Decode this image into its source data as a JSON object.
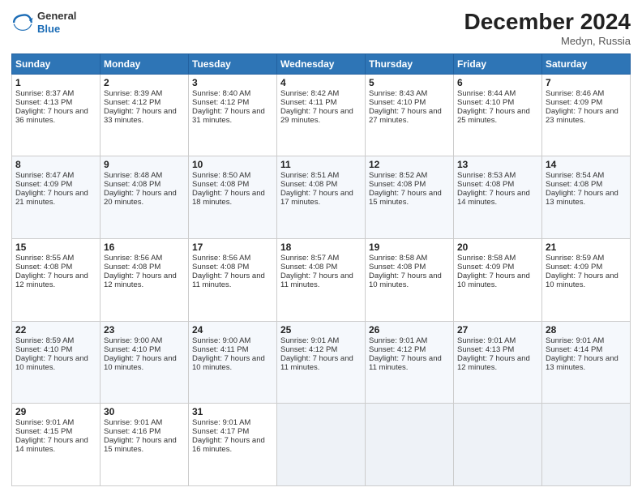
{
  "header": {
    "logo_general": "General",
    "logo_blue": "Blue",
    "month": "December 2024",
    "location": "Medyn, Russia"
  },
  "weekdays": [
    "Sunday",
    "Monday",
    "Tuesday",
    "Wednesday",
    "Thursday",
    "Friday",
    "Saturday"
  ],
  "weeks": [
    [
      {
        "day": "1",
        "sunrise": "8:37 AM",
        "sunset": "4:13 PM",
        "daylight": "7 hours and 36 minutes."
      },
      {
        "day": "2",
        "sunrise": "8:39 AM",
        "sunset": "4:12 PM",
        "daylight": "7 hours and 33 minutes."
      },
      {
        "day": "3",
        "sunrise": "8:40 AM",
        "sunset": "4:12 PM",
        "daylight": "7 hours and 31 minutes."
      },
      {
        "day": "4",
        "sunrise": "8:42 AM",
        "sunset": "4:11 PM",
        "daylight": "7 hours and 29 minutes."
      },
      {
        "day": "5",
        "sunrise": "8:43 AM",
        "sunset": "4:10 PM",
        "daylight": "7 hours and 27 minutes."
      },
      {
        "day": "6",
        "sunrise": "8:44 AM",
        "sunset": "4:10 PM",
        "daylight": "7 hours and 25 minutes."
      },
      {
        "day": "7",
        "sunrise": "8:46 AM",
        "sunset": "4:09 PM",
        "daylight": "7 hours and 23 minutes."
      }
    ],
    [
      {
        "day": "8",
        "sunrise": "8:47 AM",
        "sunset": "4:09 PM",
        "daylight": "7 hours and 21 minutes."
      },
      {
        "day": "9",
        "sunrise": "8:48 AM",
        "sunset": "4:08 PM",
        "daylight": "7 hours and 20 minutes."
      },
      {
        "day": "10",
        "sunrise": "8:50 AM",
        "sunset": "4:08 PM",
        "daylight": "7 hours and 18 minutes."
      },
      {
        "day": "11",
        "sunrise": "8:51 AM",
        "sunset": "4:08 PM",
        "daylight": "7 hours and 17 minutes."
      },
      {
        "day": "12",
        "sunrise": "8:52 AM",
        "sunset": "4:08 PM",
        "daylight": "7 hours and 15 minutes."
      },
      {
        "day": "13",
        "sunrise": "8:53 AM",
        "sunset": "4:08 PM",
        "daylight": "7 hours and 14 minutes."
      },
      {
        "day": "14",
        "sunrise": "8:54 AM",
        "sunset": "4:08 PM",
        "daylight": "7 hours and 13 minutes."
      }
    ],
    [
      {
        "day": "15",
        "sunrise": "8:55 AM",
        "sunset": "4:08 PM",
        "daylight": "7 hours and 12 minutes."
      },
      {
        "day": "16",
        "sunrise": "8:56 AM",
        "sunset": "4:08 PM",
        "daylight": "7 hours and 12 minutes."
      },
      {
        "day": "17",
        "sunrise": "8:56 AM",
        "sunset": "4:08 PM",
        "daylight": "7 hours and 11 minutes."
      },
      {
        "day": "18",
        "sunrise": "8:57 AM",
        "sunset": "4:08 PM",
        "daylight": "7 hours and 11 minutes."
      },
      {
        "day": "19",
        "sunrise": "8:58 AM",
        "sunset": "4:08 PM",
        "daylight": "7 hours and 10 minutes."
      },
      {
        "day": "20",
        "sunrise": "8:58 AM",
        "sunset": "4:09 PM",
        "daylight": "7 hours and 10 minutes."
      },
      {
        "day": "21",
        "sunrise": "8:59 AM",
        "sunset": "4:09 PM",
        "daylight": "7 hours and 10 minutes."
      }
    ],
    [
      {
        "day": "22",
        "sunrise": "8:59 AM",
        "sunset": "4:10 PM",
        "daylight": "7 hours and 10 minutes."
      },
      {
        "day": "23",
        "sunrise": "9:00 AM",
        "sunset": "4:10 PM",
        "daylight": "7 hours and 10 minutes."
      },
      {
        "day": "24",
        "sunrise": "9:00 AM",
        "sunset": "4:11 PM",
        "daylight": "7 hours and 10 minutes."
      },
      {
        "day": "25",
        "sunrise": "9:01 AM",
        "sunset": "4:12 PM",
        "daylight": "7 hours and 11 minutes."
      },
      {
        "day": "26",
        "sunrise": "9:01 AM",
        "sunset": "4:12 PM",
        "daylight": "7 hours and 11 minutes."
      },
      {
        "day": "27",
        "sunrise": "9:01 AM",
        "sunset": "4:13 PM",
        "daylight": "7 hours and 12 minutes."
      },
      {
        "day": "28",
        "sunrise": "9:01 AM",
        "sunset": "4:14 PM",
        "daylight": "7 hours and 13 minutes."
      }
    ],
    [
      {
        "day": "29",
        "sunrise": "9:01 AM",
        "sunset": "4:15 PM",
        "daylight": "7 hours and 14 minutes."
      },
      {
        "day": "30",
        "sunrise": "9:01 AM",
        "sunset": "4:16 PM",
        "daylight": "7 hours and 15 minutes."
      },
      {
        "day": "31",
        "sunrise": "9:01 AM",
        "sunset": "4:17 PM",
        "daylight": "7 hours and 16 minutes."
      },
      null,
      null,
      null,
      null
    ]
  ],
  "labels": {
    "sunrise": "Sunrise:",
    "sunset": "Sunset:",
    "daylight": "Daylight:"
  }
}
